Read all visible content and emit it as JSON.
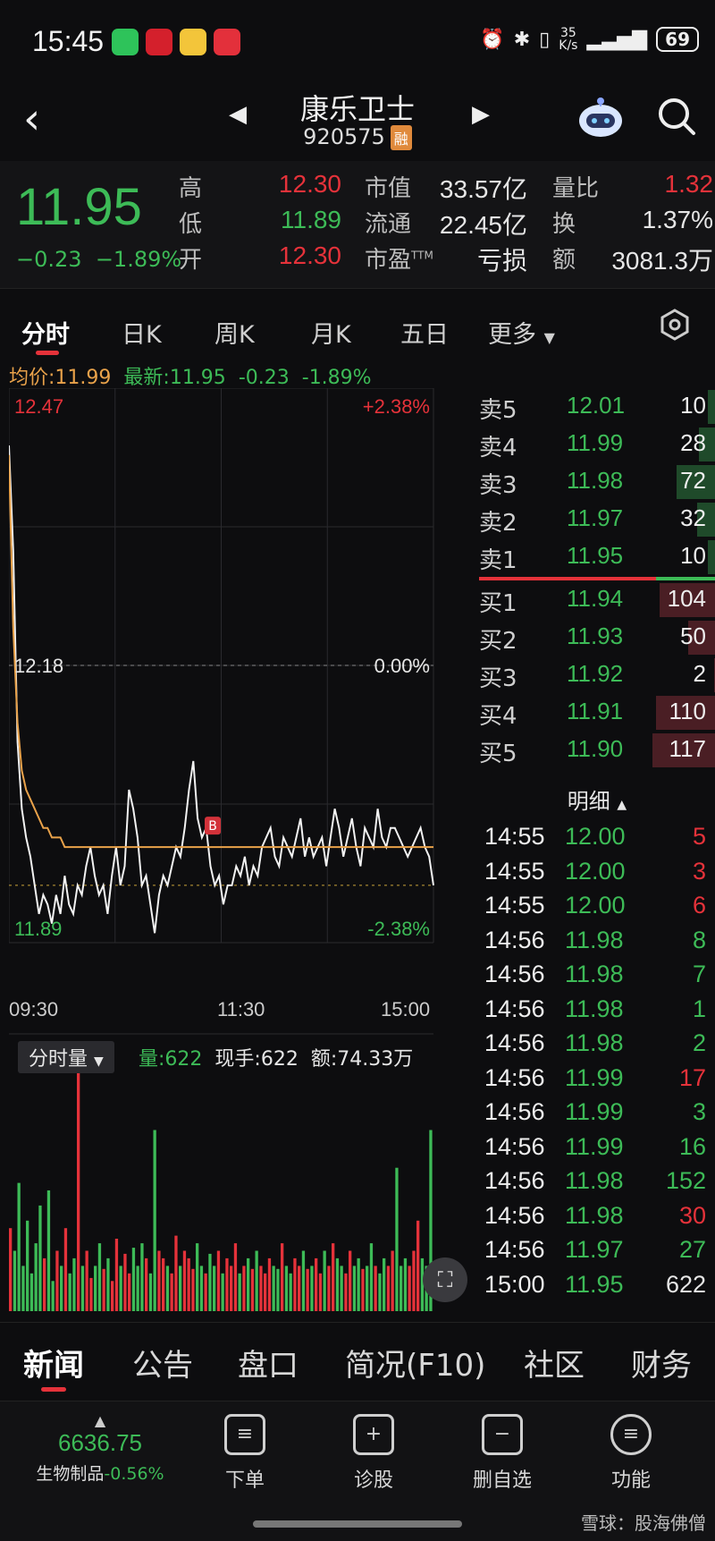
{
  "status": {
    "time": "15:45",
    "net_speed_top": "35",
    "net_speed_unit": "K/s",
    "battery": "69"
  },
  "header": {
    "name": "康乐卫士",
    "code": "920575",
    "badge": "融"
  },
  "quote": {
    "price": "11.95",
    "change": "−0.23",
    "change_pct": "−1.89%",
    "rows": [
      {
        "l1": "高",
        "v1": "12.30",
        "c1": "#e5323a",
        "l2": "市值",
        "v2": "33.57亿",
        "l3": "量比",
        "v3": "1.32",
        "c3": "#e5323a"
      },
      {
        "l1": "低",
        "v1": "11.89",
        "c1": "#3dbb57",
        "l2": "流通",
        "v2": "22.45亿",
        "l3": "换",
        "v3": "1.37%",
        "c3": "#e6e6e6"
      },
      {
        "l1": "开",
        "v1": "12.30",
        "c1": "#e5323a",
        "l2": "市盈",
        "l2sup": "TTM",
        "v2": "亏损",
        "l3": "额",
        "v3": "3081.3万",
        "c3": "#e6e6e6"
      }
    ]
  },
  "tabs": [
    "分时",
    "日K",
    "周K",
    "月K",
    "五日",
    "更多"
  ],
  "avg_line": {
    "avg": "均价:11.99",
    "latest": "最新:11.95",
    "chg": "-0.23",
    "pct": "-1.89%"
  },
  "chart_labels": {
    "ytop": "12.47",
    "ymid": "12.18",
    "ybot": "11.89",
    "ptop": "+2.38%",
    "pmid": "0.00%",
    "pbot": "-2.38%",
    "t1": "09:30",
    "t2": "11:30",
    "t3": "15:00",
    "marker": "B"
  },
  "volume": {
    "selector": "分时量",
    "vol": "量:622",
    "cur": "现手:622",
    "amt": "额:74.33万"
  },
  "orderbook": {
    "sell": [
      {
        "label": "卖5",
        "price": "12.01",
        "vol": "10",
        "fill": 0.12
      },
      {
        "label": "卖4",
        "price": "11.99",
        "vol": "28",
        "fill": 0.25
      },
      {
        "label": "卖3",
        "price": "11.98",
        "vol": "72",
        "fill": 0.62
      },
      {
        "label": "卖2",
        "price": "11.97",
        "vol": "32",
        "fill": 0.28
      },
      {
        "label": "卖1",
        "price": "11.95",
        "vol": "10",
        "fill": 0.12
      }
    ],
    "buy": [
      {
        "label": "买1",
        "price": "11.94",
        "vol": "104",
        "fill": 0.89
      },
      {
        "label": "买2",
        "price": "11.93",
        "vol": "50",
        "fill": 0.43
      },
      {
        "label": "买3",
        "price": "11.92",
        "vol": "2",
        "fill": 0.02
      },
      {
        "label": "买4",
        "price": "11.91",
        "vol": "110",
        "fill": 0.94
      },
      {
        "label": "买5",
        "price": "11.90",
        "vol": "117",
        "fill": 1.0
      }
    ]
  },
  "detail": {
    "header": "明细",
    "rows": [
      {
        "time": "14:55",
        "price": "12.00",
        "vol": "5",
        "color": "#e5323a"
      },
      {
        "time": "14:55",
        "price": "12.00",
        "vol": "3",
        "color": "#e5323a"
      },
      {
        "time": "14:55",
        "price": "12.00",
        "vol": "6",
        "color": "#e5323a"
      },
      {
        "time": "14:56",
        "price": "11.98",
        "vol": "8",
        "color": "#3dbb57"
      },
      {
        "time": "14:56",
        "price": "11.98",
        "vol": "7",
        "color": "#3dbb57"
      },
      {
        "time": "14:56",
        "price": "11.98",
        "vol": "1",
        "color": "#3dbb57"
      },
      {
        "time": "14:56",
        "price": "11.98",
        "vol": "2",
        "color": "#3dbb57"
      },
      {
        "time": "14:56",
        "price": "11.99",
        "vol": "17",
        "color": "#e5323a"
      },
      {
        "time": "14:56",
        "price": "11.99",
        "vol": "3",
        "color": "#3dbb57"
      },
      {
        "time": "14:56",
        "price": "11.99",
        "vol": "16",
        "color": "#3dbb57"
      },
      {
        "time": "14:56",
        "price": "11.98",
        "vol": "152",
        "color": "#3dbb57"
      },
      {
        "time": "14:56",
        "price": "11.98",
        "vol": "30",
        "color": "#e5323a"
      },
      {
        "time": "14:56",
        "price": "11.97",
        "vol": "27",
        "color": "#3dbb57"
      },
      {
        "time": "15:00",
        "price": "11.95",
        "vol": "622",
        "color": "#e6e6e6"
      }
    ]
  },
  "news_tabs": [
    "新闻",
    "公告",
    "盘口",
    "简况(F10)",
    "社区",
    "财务"
  ],
  "bottom": {
    "index_value": "6636.75",
    "index_name": "生物制品",
    "index_pct": "-0.56%",
    "items": [
      "下单",
      "诊股",
      "删自选",
      "功能"
    ],
    "watermark": "雪球：股海佛僧"
  },
  "chart_data": {
    "type": "line",
    "xlabel": "",
    "ylabel": "",
    "x_ticks": [
      "09:30",
      "11:30",
      "15:00"
    ],
    "ylim": [
      11.89,
      12.47
    ],
    "prev_close": 12.18,
    "series": [
      {
        "values": [
          12.41,
          12.3,
          12.1,
          12.03,
          12.0,
          11.98,
          11.95,
          11.92,
          11.94,
          11.93,
          11.91,
          11.94,
          11.92,
          11.96,
          11.93,
          11.92,
          11.95,
          11.94,
          11.97,
          11.99,
          11.96,
          11.94,
          11.95,
          11.92,
          11.96,
          11.99,
          11.95,
          11.97,
          12.05,
          12.03,
          12.0,
          11.95,
          11.96,
          11.93,
          11.9,
          11.94,
          11.96,
          11.95,
          11.97,
          11.99,
          11.98,
          12.01,
          12.05,
          12.08,
          12.02,
          12.0,
          12.01,
          11.97,
          11.95,
          11.96,
          11.93,
          11.95,
          11.95,
          11.97,
          11.96,
          11.98,
          11.95,
          11.97,
          11.96,
          11.99,
          12.0,
          12.01,
          11.98,
          11.97,
          12.0,
          11.99,
          11.98,
          12.0,
          12.02,
          11.98,
          12.0,
          11.98,
          11.99,
          12.0,
          11.97,
          12.0,
          12.03,
          12.01,
          11.98,
          12.0,
          12.02,
          11.99,
          11.97,
          12.01,
          12.0,
          11.99,
          12.03,
          12.0,
          11.99,
          12.01,
          12.01,
          12.0,
          11.99,
          11.98,
          11.99,
          12.0,
          12.01,
          11.99,
          11.98,
          11.95
        ]
      },
      {
        "values": [
          12.4,
          12.22,
          12.12,
          12.07,
          12.05,
          12.04,
          12.03,
          12.02,
          12.01,
          12.01,
          12.0,
          12.0,
          12.0,
          11.99,
          11.99,
          11.99,
          11.99,
          11.99,
          11.99,
          11.99,
          11.99,
          11.99,
          11.99,
          11.99,
          11.99,
          11.99,
          11.99,
          11.99,
          11.99,
          11.99,
          11.99,
          11.99,
          11.99,
          11.99,
          11.99,
          11.99,
          11.99,
          11.99,
          11.99,
          11.99,
          11.99,
          11.99,
          11.99,
          11.99,
          11.99,
          11.99,
          11.99,
          11.99,
          11.99,
          11.99,
          11.99,
          11.99,
          11.99,
          11.99,
          11.99,
          11.99,
          11.99,
          11.99,
          11.99,
          11.99,
          11.99,
          11.99,
          11.99,
          11.99,
          11.99,
          11.99,
          11.99,
          11.99,
          11.99,
          11.99,
          11.99,
          11.99,
          11.99,
          11.99,
          11.99,
          11.99,
          11.99,
          11.99,
          11.99,
          11.99,
          11.99,
          11.99,
          11.99,
          11.99,
          11.99,
          11.99,
          11.99,
          11.99,
          11.99,
          11.99,
          11.99,
          11.99,
          11.99,
          11.99,
          11.99,
          11.99,
          11.99,
          11.99,
          11.99,
          11.99
        ]
      }
    ],
    "volume": [
      55,
      40,
      85,
      30,
      60,
      25,
      45,
      70,
      35,
      80,
      20,
      40,
      30,
      55,
      25,
      35,
      160,
      30,
      40,
      22,
      30,
      45,
      28,
      35,
      20,
      48,
      30,
      38,
      25,
      42,
      30,
      45,
      35,
      25,
      120,
      40,
      35,
      30,
      25,
      50,
      30,
      40,
      35,
      28,
      45,
      30,
      25,
      38,
      30,
      40,
      25,
      35,
      30,
      45,
      25,
      30,
      35,
      28,
      40,
      30,
      25,
      35,
      30,
      28,
      45,
      30,
      25,
      35,
      30,
      40,
      28,
      30,
      35,
      25,
      40,
      30,
      45,
      35,
      30,
      25,
      40,
      30,
      35,
      28,
      30,
      45,
      30,
      25,
      35,
      30,
      40,
      95,
      30,
      35,
      30,
      40,
      60,
      35,
      30,
      120
    ]
  }
}
